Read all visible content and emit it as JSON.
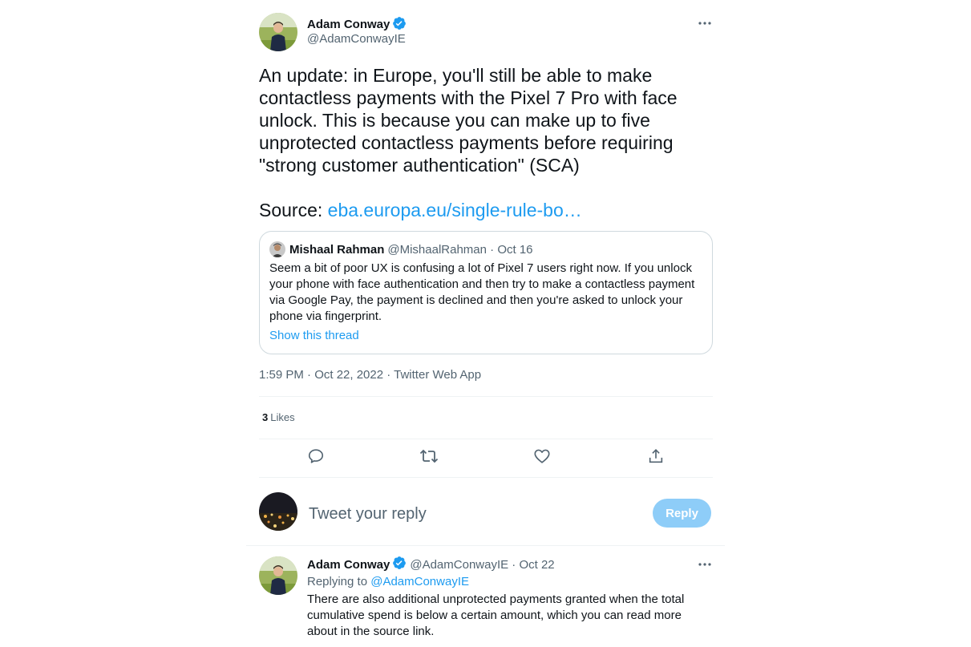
{
  "main_tweet": {
    "author_name": "Adam Conway",
    "handle": "@AdamConwayIE",
    "text_lines": [
      "An update: in Europe, you'll still be able to make",
      "contactless payments with the Pixel 7 Pro with face",
      "unlock. This is because you can make up to five",
      "unprotected contactless payments before requiring",
      "\"strong customer authentication\" (SCA)"
    ],
    "source_label": "Source: ",
    "source_link": "eba.europa.eu/single-rule-bo…",
    "timestamp": "1:59 PM · Oct 22, 2022 · Twitter Web App",
    "likes_count": "3",
    "likes_label": "Likes"
  },
  "quote_tweet": {
    "author_name": "Mishaal Rahman",
    "meta": "@MishaalRahman · Oct 16",
    "text_lines": [
      "Seem a bit of poor UX is confusing a lot of Pixel 7 users right now. If you unlock",
      "your phone with face authentication and then try to make a contactless payment",
      "via Google Pay, the payment is declined and then you're asked to unlock your",
      "phone via fingerprint."
    ],
    "show_thread": "Show this thread"
  },
  "actions": {
    "reply_icon": "comment-icon",
    "retweet_icon": "retweet-icon",
    "like_icon": "heart-icon",
    "share_icon": "share-icon"
  },
  "composer": {
    "placeholder": "Tweet your reply",
    "button_label": "Reply"
  },
  "reply_tweet": {
    "author_name": "Adam Conway",
    "meta": "@AdamConwayIE · Oct 22",
    "replying_label": "Replying to ",
    "replying_handle": "@AdamConwayIE",
    "text_lines": [
      "There are also additional unprotected payments granted when the total",
      "cumulative spend is below a certain amount, which you can read more",
      "about in the source link."
    ]
  },
  "colors": {
    "link": "#1d9bf0",
    "secondary_text": "#536471",
    "primary_text": "#0f1419",
    "reply_button_disabled": "#8ecdf8",
    "verified_badge": "#1d9bf0"
  }
}
